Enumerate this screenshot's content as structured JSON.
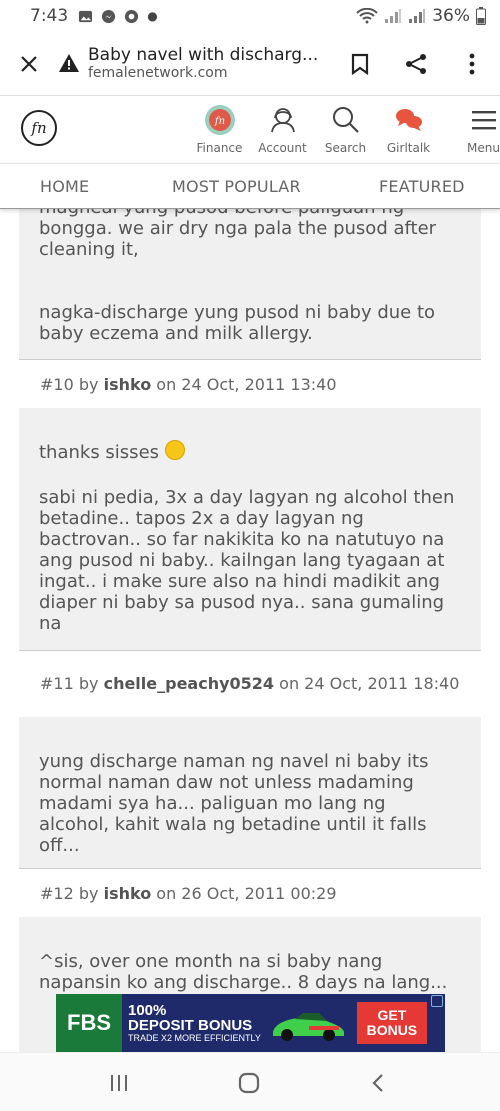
{
  "status": {
    "time": "7:43",
    "battery": "36%"
  },
  "browser": {
    "page_title": "Baby navel with discharg...",
    "domain": "femalenetwork.com"
  },
  "site": {
    "logo_text": "fn",
    "nav": [
      {
        "label": "Finance",
        "icon": "fn-circle-icon"
      },
      {
        "label": "Account",
        "icon": "account-icon"
      },
      {
        "label": "Search",
        "icon": "search-icon"
      },
      {
        "label": "Girltalk",
        "icon": "chat-bubbles-icon"
      },
      {
        "label": "Menu",
        "icon": "hamburger-icon"
      }
    ],
    "tabs": [
      "HOME",
      "MOST POPULAR",
      "FEATURED"
    ]
  },
  "posts": [
    {
      "paragraphs": [
        "magheal yung pusod before paliguan ng bongga. we air dry nga pala the pusod after cleaning it,",
        "nagka-discharge yung pusod ni baby due to baby eczema and milk allergy."
      ]
    },
    {
      "meta": {
        "number": "#10",
        "by": "by",
        "author": "ishko",
        "on": "on 24 Oct, 2011 13:40"
      },
      "paragraphs": [
        "thanks sisses",
        "sabi ni pedia, 3x a day lagyan ng alcohol then betadine.. tapos 2x a day lagyan ng bactrovan.. so far nakikita ko na natutuyo na ang pusod ni baby.. kailngan lang tyagaan at ingat.. i make sure also na hindi madikit ang diaper ni baby sa pusod nya.. sana gumaling na"
      ]
    },
    {
      "meta": {
        "number": "#11",
        "by": "by",
        "author": "chelle_peachy0524",
        "on": "on 24 Oct, 2011 18:40"
      },
      "paragraphs": [
        "yung discharge naman ng navel ni baby its normal naman daw not unless madaming madami sya ha... paliguan mo lang ng alcohol, kahit wala ng betadine until it falls off..."
      ]
    },
    {
      "meta": {
        "number": "#12",
        "by": "by",
        "author": "ishko",
        "on": "on 26 Oct, 2011 00:29"
      },
      "paragraphs": [
        "^sis, over one month na si baby nang napansin ko ang discharge.. 8 days na lang..."
      ]
    }
  ],
  "ad": {
    "brand": "FBS",
    "line1": "100%",
    "line2": "DEPOSIT BONUS",
    "line3": "TRADE X2 MORE EFFICIENTLY",
    "cta1": "GET",
    "cta2": "BONUS"
  }
}
